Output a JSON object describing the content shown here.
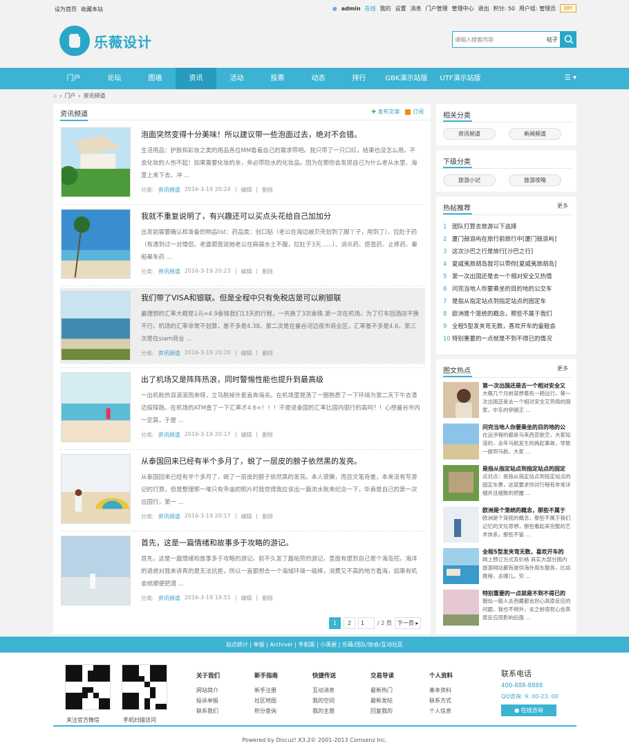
{
  "topbar": {
    "left": [
      "设为首页",
      "收藏本站"
    ],
    "user": "admin",
    "status": "在线",
    "links": [
      "我的",
      "设置",
      "消息",
      "门户管理",
      "管理中心",
      "退出",
      "积分: 50",
      "用户组: 管理员"
    ],
    "diy": "DIY"
  },
  "header": {
    "logo_text": "乐薇设计",
    "search_placeholder": "请输入搜索内容",
    "search_type": "帖子"
  },
  "nav": {
    "items": [
      "门户",
      "论坛",
      "图墙",
      "资讯",
      "活动",
      "投票",
      "动态",
      "排行",
      "GBK演示站版",
      "UTF演示站版"
    ],
    "active_index": 3
  },
  "breadcrumb": [
    "门户",
    "资讯频道"
  ],
  "main": {
    "title": "资讯频道",
    "actions": [
      "发布文章",
      "订阅"
    ],
    "edit_label": "编辑",
    "delete_label": "删除",
    "category_prefix": "分类:",
    "articles": [
      {
        "title": "泡面突然变得十分美味！所以建议带一些泡面过去，绝对不会错。",
        "summary": "生活用品：护肤和彩妆之类的用品各位MM看着自己的需求带吧。我只带了一只口红，结果也没怎么用。不会化妆的人伤不起！如果需要化妆的亲，务必带防水的化妆品。因为在那你会发现自己为什么老从水里、海里上来下去，冲 ...",
        "category": "资讯频道",
        "date": "2016-3-19 20:24"
      },
      {
        "title": "我就不重复说明了，有兴趣还可以买点头花给自己加加分",
        "summary": "出发前需要确认和准备的物品list：药品类：创口贴（老公在海边被贝壳划到了脚丫子，用到了）、拉肚子药（有遇到过一对情侣，老婆跟我说她老公在麻袋水土不服，拉肚子3天......）、消炎药、感冒药、止疼药、晕船晕车药 ...",
        "category": "资讯频道",
        "date": "2016-3-19 20:23"
      },
      {
        "title": "我们带了VISA和银联。但是全程中只有免税店是可以刷银联",
        "summary": "最理想的汇率大概是1元=4.9泰铢我们13天的行程，一共换了3次泰铢.第一次在机场，为了打车回酒店不换不行。机场的汇率非常不划算，差不多是4.38。第二次是在曼谷河边夜市商业区，汇率差不多是4.6。第三次是在siam商业 ...",
        "category": "资讯频道",
        "date": "2016-3-19 20:20"
      },
      {
        "title": "出了机场又是阵阵热浪，同时警惕性能也提升到最高级",
        "summary": "一出机舱热浪滚滚而来呀，立马脱掉外套直奔海关。在机场里晃荡了一圈熟悉了一下环境为第二天下午去清迈探探路。在机场的ATM查了一下汇率才4.6+！！！不是说泰国的汇率比国内银行的高吗？！心想曼谷市内一定高，于是 ...",
        "category": "资讯频道",
        "date": "2016-3-19 20:17"
      },
      {
        "title": "从泰国回来已经有半个多月了，蜕了一层皮的膀子依然黑的发亮。",
        "summary": "从泰国回来已经有半个多月了，蜕了一层皮的膀子依然黑的发亮。本人很懒，而且文笔奇差，本来没有写游记的打算，但是整理那一堆只有寺庙的照片时我觉得我应该出一篇流水账来纪念一下，毕竟是自己的第一次出国行，第一 ...",
        "category": "资讯频道",
        "date": "2016-3-19 20:17"
      },
      {
        "title": "首先，这是一篇情绪和故事多于攻略的游记。",
        "summary": "首先，这是一篇情绪和故事多于攻略的游记。前不久发了篇帕劳的游记，里面有提到自己是个海岛控。海洋的诱惑对我来讲真的是无法抗拒，所以一直都想去一个海域环境一级棒，消费又不高的地方看海，如果有机会就顺便把潜 ...",
        "category": "资讯频道",
        "date": "2016-3-19 19:51"
      }
    ],
    "pager": {
      "current": "1",
      "next_page": "2",
      "input": "1",
      "total": "/ 2 页",
      "next": "下一页"
    }
  },
  "sidebar": {
    "related": {
      "title": "相关分类",
      "items": [
        "资讯频道",
        "新闻频道"
      ]
    },
    "sub": {
      "title": "下级分类",
      "items": [
        "旅游小记",
        "旅游攻略"
      ]
    },
    "hot": {
      "title": "热帖推荐",
      "more": "更多",
      "items": [
        "团队打算去旅游以下选择",
        "厦门鼓浪屿在旅行前旅行中[厦门鼓浪屿]",
        "这次沙巴之行是旅行[沙巴之行]",
        "夏威夷旅胡岛我可以带你[夏威夷旅胡岛]",
        "第一次出国还是去一个相对安全又热情",
        "问完当地人你要乘坐的目的地的公交车",
        "是指从指定站点到指定站点的固定车",
        "欧洲是个笼统的概念，那些不属于我们",
        "全程5型发夹弯无数，喜欢开车的童鞋会",
        "特别重要的一点就是不到不得已的情况"
      ]
    },
    "pics": {
      "title": "图文热点",
      "more": "更多",
      "items": [
        {
          "title": "第一次出国还是去一个相对安全又",
          "desc": "大概几个月前就想着有一趟远行，第一次出国还是去一个相对安全又热情的国家，中东的伊朗正 ..."
        },
        {
          "title": "问完当地人你要乘坐的目的地的公",
          "desc": "在远涉程的都是马来西亚航空，大家知道的，去年马航发生的两起事故，导致一提到马航，大家 ..."
        },
        {
          "title": "是指从指定站点到指定站点的固定",
          "desc": "点对点：是指从指定站点到指定站点的固定车票，这就要求你对行程有非常详细并且细致的把握 ..."
        },
        {
          "title": "欧洲是个笼统的概念，那些不属于",
          "desc": "欧洲是个笼统的概念，那些不属于我们记忆的文化思想，那些看起来完整的艺术体系，那些不管 ..."
        },
        {
          "title": "全程5型发夹弯无数，喜欢开车的",
          "desc": "网上预订方式及价格 其实大部分国内旅游网站都有提供海外用车服务，比如携程，去哪儿，穷 ..."
        },
        {
          "title": "特别重要的一点就是不到不得已的",
          "desc": "貌似一般人去西藏都会担心高原反应的问题，我也不例外，去之前很担心会高原反应而影响后面 ..."
        }
      ]
    }
  },
  "footer": {
    "bar": "站点统计 | 举报 | Archiver | 手机版 | 小黑屋 | 乐薇/团队/协会/互动社区",
    "qr_captions": [
      "关注官方微信",
      "手机扫描访问"
    ],
    "columns": [
      {
        "title": "关于我们",
        "links": [
          "网站简介",
          "投诉举报",
          "联系我们"
        ]
      },
      {
        "title": "新手指南",
        "links": [
          "新手注册",
          "社区地图",
          "积分查询"
        ]
      },
      {
        "title": "快捷传送",
        "links": [
          "互动消息",
          "我的空间",
          "我的主题"
        ]
      },
      {
        "title": "交易导读",
        "links": [
          "最新热门",
          "最新发帖",
          "回复我的"
        ]
      },
      {
        "title": "个人资料",
        "links": [
          "基本资料",
          "联系方式",
          "个人信息"
        ]
      }
    ],
    "contact": {
      "title": "联系电话",
      "tel": "400-888-8888",
      "qq": "QQ咨询: 9: 00-23: 00",
      "button": "在线咨询"
    },
    "copyright": "Powered by Discuz! X3.2© 2001-2013 Comsenz Inc."
  },
  "colors": {
    "accent": "#3cb3d2",
    "accent_dark": "#279cbd",
    "link": "#3aa0c5"
  }
}
